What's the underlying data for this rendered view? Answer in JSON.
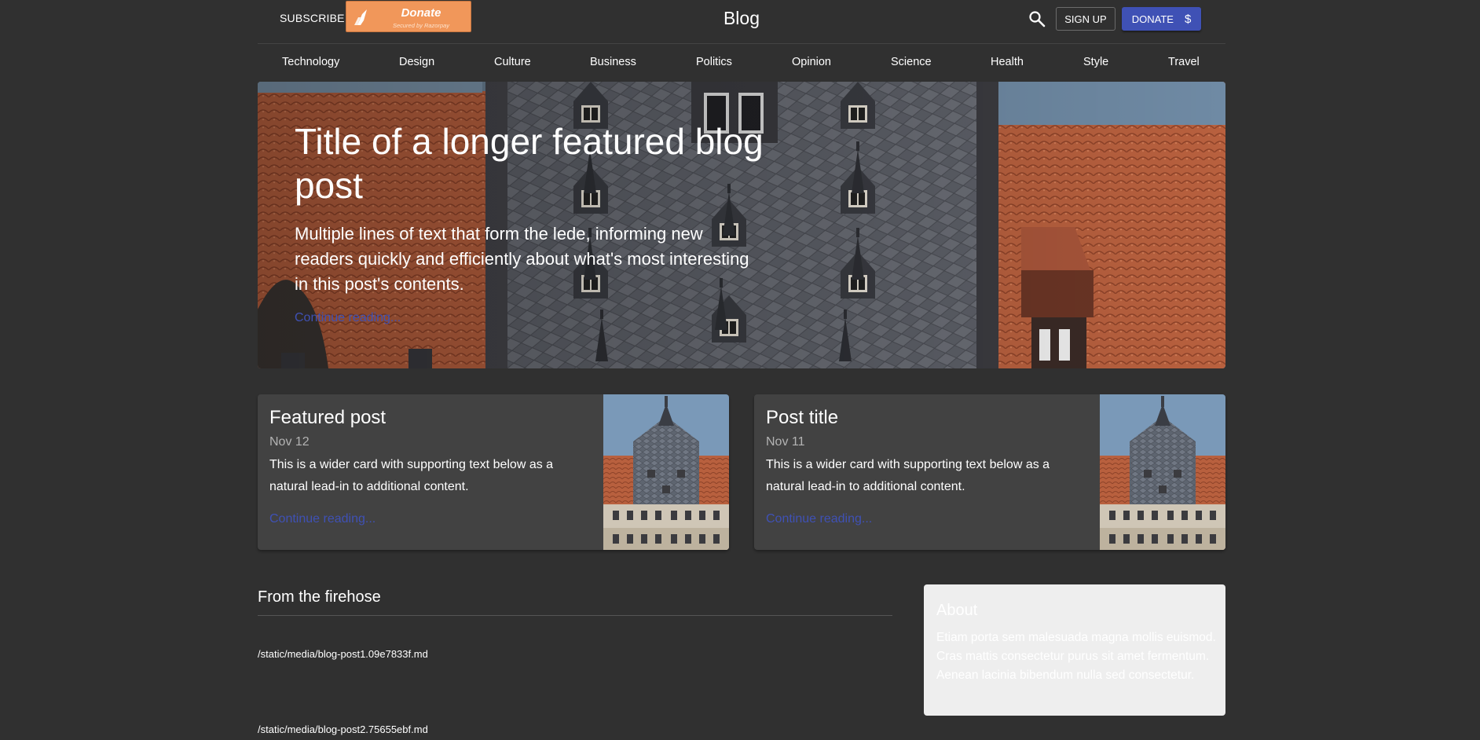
{
  "header": {
    "subscribe_label": "SUBSCRIBE",
    "donate_badge": {
      "title": "Donate",
      "subtitle": "Secured by Razorpay",
      "color": "#f1975a"
    },
    "brand": "Blog",
    "search_icon": "search-icon",
    "signup_label": "SIGN UP",
    "donate_label": "DONATE",
    "donate_symbol": "$",
    "accent": "#3f51b5"
  },
  "nav": {
    "items": [
      {
        "label": "Technology"
      },
      {
        "label": "Design"
      },
      {
        "label": "Culture"
      },
      {
        "label": "Business"
      },
      {
        "label": "Politics"
      },
      {
        "label": "Opinion"
      },
      {
        "label": "Science"
      },
      {
        "label": "Health"
      },
      {
        "label": "Style"
      },
      {
        "label": "Travel"
      }
    ]
  },
  "hero": {
    "title": "Title of a longer featured blog post",
    "lede": "Multiple lines of text that form the lede, informing new readers quickly and efficiently about what's most interesting in this post's contents.",
    "link": "Continue reading..."
  },
  "cards": [
    {
      "title": "Featured post",
      "date": "Nov 12",
      "description": "This is a wider card with supporting text below as a natural lead-in to additional content.",
      "link": "Continue reading..."
    },
    {
      "title": "Post title",
      "date": "Nov 11",
      "description": "This is a wider card with supporting text below as a natural lead-in to additional content.",
      "link": "Continue reading..."
    }
  ],
  "main": {
    "section_title": "From the firehose",
    "posts": [
      {
        "path": "/static/media/blog-post1.09e7833f.md"
      },
      {
        "path": "/static/media/blog-post2.75655ebf.md"
      }
    ]
  },
  "sidebar": {
    "about_title": "About",
    "about_text": "Etiam porta sem malesuada magna mollis euismod. Cras mattis consectetur purus sit amet fermentum. Aenean lacinia bibendum nulla sed consectetur."
  }
}
